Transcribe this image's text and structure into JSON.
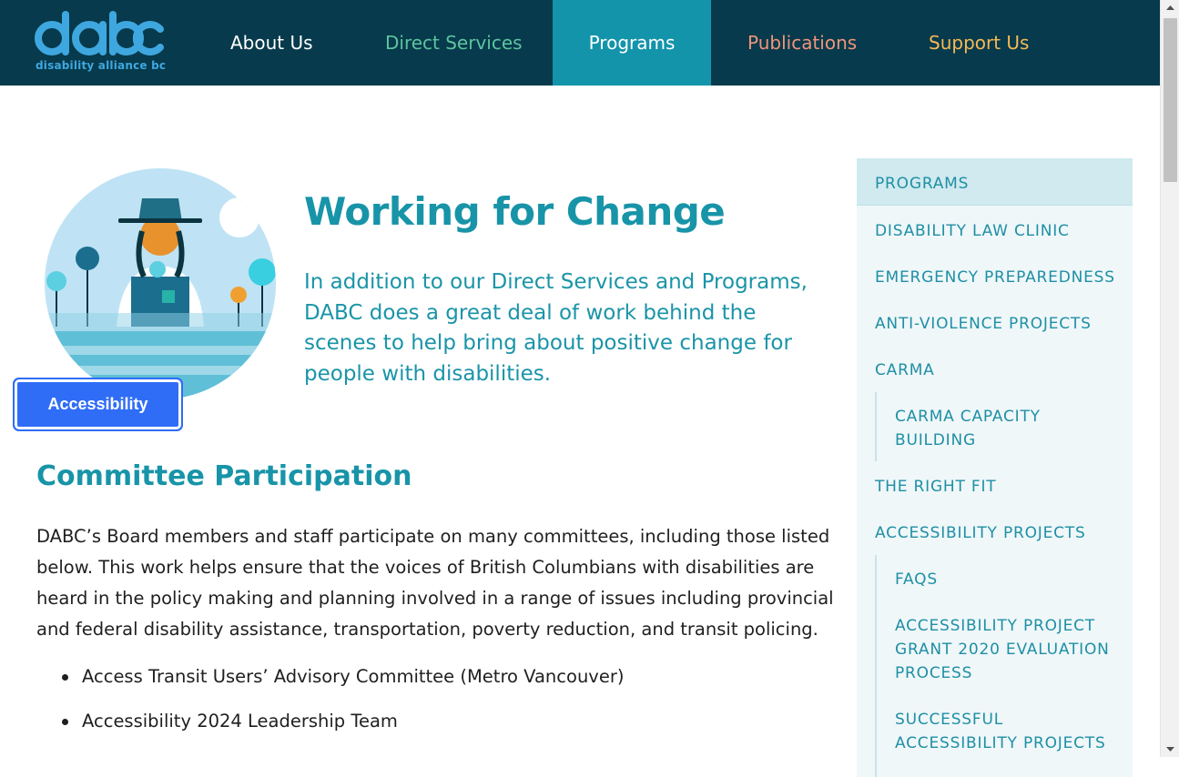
{
  "logo": {
    "wordmark": "dabc",
    "subtitle": "disability alliance bc"
  },
  "nav": {
    "about": "About Us",
    "direct": "Direct Services",
    "programs": "Programs",
    "publications": "Publications",
    "support": "Support Us"
  },
  "colors": {
    "header_bg": "#063a4c",
    "active_tab": "#1394aa",
    "accent": "#1894a8",
    "button": "#2f6df6"
  },
  "hero": {
    "title": "Working for Change",
    "intro": "In addition to our Direct Services and Programs, DABC does a great deal of work behind the scenes to help bring about positive change for people with disabilities."
  },
  "accessibility_button": "Accessibility",
  "section": {
    "title": "Committee Participation",
    "body": "DABC’s Board members and staff participate on many committees, including those listed below. This work helps ensure that the voices of British Columbians with disabilities are heard in the policy making and planning involved in a range of issues including provincial and federal disability assistance, transportation, poverty reduction, and transit policing.",
    "items": [
      "Access Transit Users’ Advisory Committee (Metro Vancouver)",
      "Accessibility 2024 Leadership Team"
    ]
  },
  "sidebar": {
    "heading": "PROGRAMS",
    "links": [
      "DISABILITY LAW CLINIC",
      "EMERGENCY PREPAREDNESS",
      "ANTI-VIOLENCE PROJECTS",
      "CARMA",
      "THE RIGHT FIT",
      "ACCESSIBILITY PROJECTS"
    ],
    "carma_sub": [
      "CARMA CAPACITY BUILDING"
    ],
    "accessibility_sub": [
      "FAQS",
      "ACCESSIBILITY PROJECT GRANT 2020 EVALUATION PROCESS",
      "SUCCESSFUL ACCESSIBILITY PROJECTS"
    ]
  }
}
